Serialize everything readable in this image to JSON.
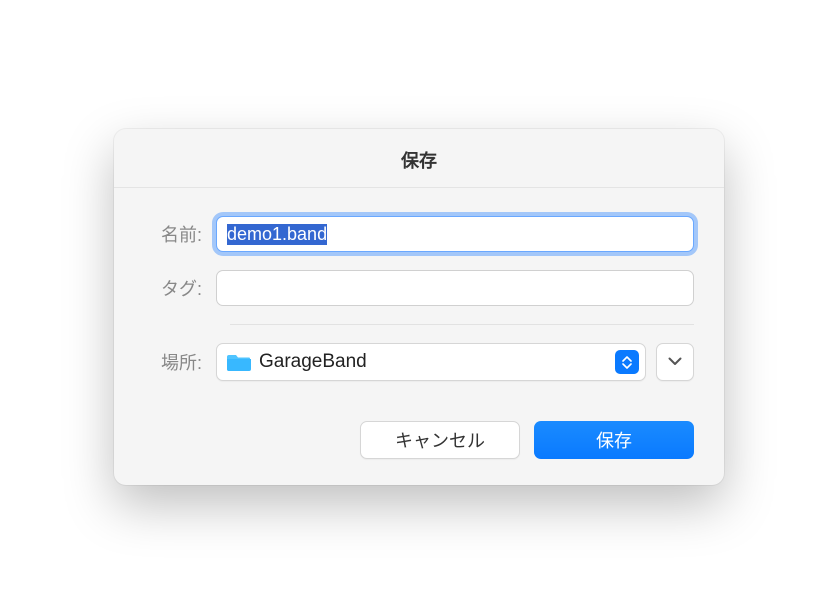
{
  "dialog": {
    "title": "保存",
    "name_label": "名前:",
    "name_value": "demo1.band",
    "tags_label": "タグ:",
    "tags_value": "",
    "location_label": "場所:",
    "location_value": "GarageBand",
    "cancel_label": "キャンセル",
    "save_label": "保存"
  }
}
